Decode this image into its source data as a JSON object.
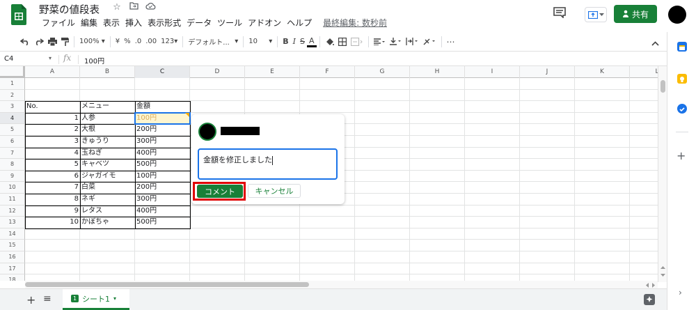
{
  "header": {
    "doc_title": "野菜の値段表",
    "star_icon": "☆",
    "menus": [
      "ファイル",
      "編集",
      "表示",
      "挿入",
      "表示形式",
      "データ",
      "ツール",
      "アドオン",
      "ヘルプ"
    ],
    "last_edit": "最終編集: 数秒前",
    "share_label": "共有",
    "brand_color": "#188038"
  },
  "toolbar": {
    "zoom": "100%",
    "currency": "¥",
    "percent": "%",
    "dec_less": ".0",
    "dec_more": ".00",
    "format_more": "123",
    "font": "デフォルト...",
    "font_size": "10",
    "bold": "B",
    "italic": "I",
    "strike": "S",
    "text_color": "A",
    "more": "⋯"
  },
  "formula_bar": {
    "cell_ref": "C4",
    "fx": "fx",
    "value": "100円"
  },
  "columns": [
    "A",
    "B",
    "C",
    "D",
    "E",
    "F",
    "G",
    "H",
    "I",
    "J",
    "K",
    "L"
  ],
  "rows": [
    "1",
    "2",
    "3",
    "4",
    "5",
    "6",
    "7",
    "8",
    "9",
    "10",
    "11",
    "12",
    "13",
    "14",
    "15",
    "16",
    "17",
    "18"
  ],
  "table": {
    "headers": [
      "No.",
      "メニュー",
      "金額"
    ],
    "rows": [
      [
        "1",
        "人参",
        "100円"
      ],
      [
        "2",
        "大根",
        "200円"
      ],
      [
        "3",
        "きゅうり",
        "300円"
      ],
      [
        "4",
        "玉ねぎ",
        "400円"
      ],
      [
        "5",
        "キャベツ",
        "500円"
      ],
      [
        "6",
        "ジャガイモ",
        "100円"
      ],
      [
        "7",
        "白菜",
        "200円"
      ],
      [
        "8",
        "ネギ",
        "300円"
      ],
      [
        "9",
        "レタス",
        "400円"
      ],
      [
        "10",
        "かぼちゃ",
        "500円"
      ]
    ]
  },
  "comment": {
    "input_text": "金額を修正しました",
    "submit_label": "コメント",
    "cancel_label": "キャンセル"
  },
  "bottom": {
    "add_sheet": "+",
    "all_sheets": "≡",
    "sheet_tab": "シート1",
    "sheet_badge": "1"
  },
  "side_panel": {
    "add": "+",
    "collapse": "›"
  }
}
